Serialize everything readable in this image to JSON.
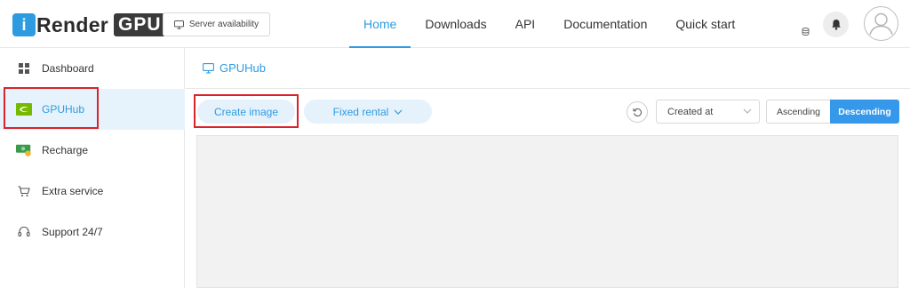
{
  "header": {
    "logo": {
      "brand": "Render",
      "badge": "GPU",
      "mark": "i"
    },
    "server_button": "Server availability",
    "nav": [
      {
        "label": "Home",
        "active": true
      },
      {
        "label": "Downloads",
        "active": false
      },
      {
        "label": "API",
        "active": false
      },
      {
        "label": "Documentation",
        "active": false
      },
      {
        "label": "Quick start",
        "active": false
      }
    ]
  },
  "sidebar": {
    "items": [
      {
        "label": "Dashboard",
        "icon": "grid-icon"
      },
      {
        "label": "GPUHub",
        "icon": "nvidia-icon",
        "active": true
      },
      {
        "label": "Recharge",
        "icon": "money-icon"
      },
      {
        "label": "Extra service",
        "icon": "cart-icon"
      },
      {
        "label": "Support 24/7",
        "icon": "headset-icon"
      }
    ]
  },
  "main": {
    "title": "GPUHub",
    "create_button": "Create image",
    "fixed_rental_button": "Fixed rental",
    "sort_select": "Created at",
    "order": {
      "ascending": "Ascending",
      "descending": "Descending",
      "selected": "Descending"
    }
  },
  "colors": {
    "accent": "#2e9be0",
    "highlight_box": "#d9232a",
    "active_bg": "#e6f3fc"
  }
}
